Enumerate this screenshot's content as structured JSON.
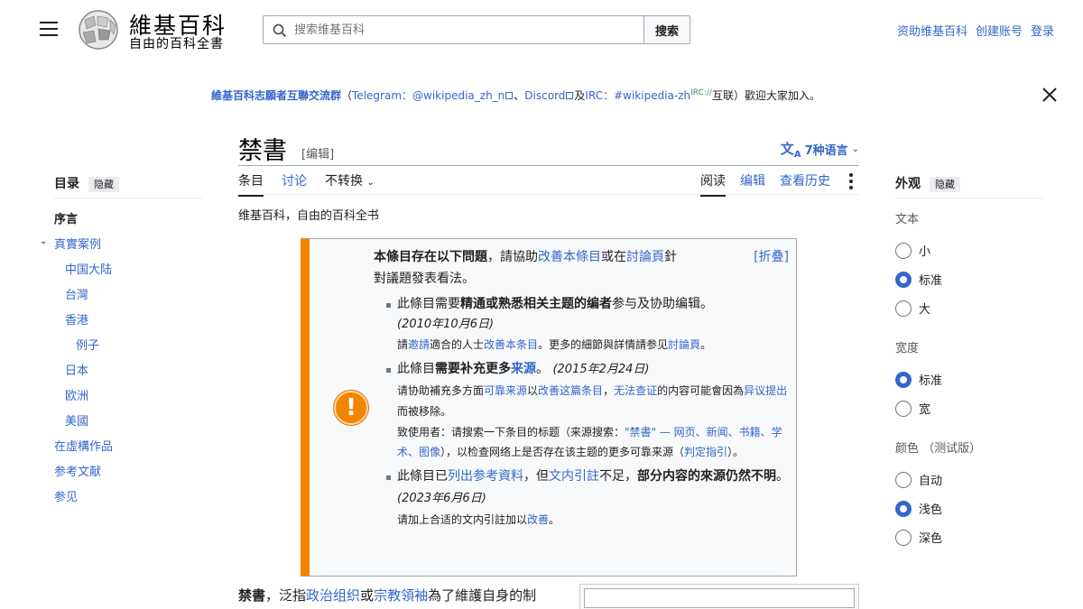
{
  "header": {
    "logo_title": "維基百科",
    "logo_tagline": "自由的百科全書",
    "search_placeholder": "搜索维基百科",
    "search_button": "搜索",
    "user_links": [
      "资助维基百科",
      "创建账号",
      "登录"
    ]
  },
  "banner": {
    "group_name": "維基百科志願者互聯交流群",
    "open_paren": "（",
    "telegram_label": "Telegram：",
    "telegram_link": "@wikipedia_zh_n",
    "sep": "、",
    "discord": "Discord",
    "and": "及",
    "irc_label": "IRC：",
    "irc_link": "#wikipedia-zh",
    "irc_sup": "IRC://",
    "tail": "互联）歡迎大家加入。"
  },
  "page": {
    "title": "禁書",
    "edit": "[编辑]",
    "languages": "7种语言",
    "tabs_left": [
      "条目",
      "讨论",
      "不转换"
    ],
    "tabs_right": [
      "阅读",
      "编辑",
      "查看历史"
    ],
    "subtitle": "维基百科，自由的百科全书"
  },
  "toc": {
    "title": "目录",
    "hide": "隐藏",
    "items": [
      "序言",
      "真實案例",
      "中国大陆",
      "台灣",
      "香港",
      "例子",
      "日本",
      "欧洲",
      "美國",
      "在虛構作品",
      "参考文献",
      "参见"
    ]
  },
  "notice": {
    "intro_bold": "本條目存在以下問題",
    "intro_mid": "，請協助",
    "intro_link1": "改善本條目",
    "intro_or": "或在",
    "intro_link2": "討論頁",
    "intro_end": "針",
    "collapse": "[折叠]",
    "intro_line2": "對議題發表看法。",
    "issue1_a": "此條目需要",
    "issue1_bold": "精通或熟悉相关主题的编者",
    "issue1_b": "参与及协助编辑。",
    "issue1_date": "(2010年10月6日)",
    "issue1_note_a": "請",
    "issue1_note_l1": "邀請",
    "issue1_note_b": "適合的人士",
    "issue1_note_l2": "改善本条目",
    "issue1_note_c": "。更多的細節與詳情請参见",
    "issue1_note_l3": "討論頁",
    "issue1_note_d": "。",
    "issue2_a": "此條目",
    "issue2_bold": "需要补充更多",
    "issue2_link": "来源",
    "issue2_b": "。",
    "issue2_date": "(2015年2月24日)",
    "issue2_n1": "请协助補充多方面",
    "issue2_n1l": "可靠来源",
    "issue2_n2": "以",
    "issue2_n2l": "改善这篇条目",
    "issue2_n3": "，",
    "issue2_n3l": "无法查证",
    "issue2_n4": "的内容可能會因為",
    "issue2_n4l": "异议提出",
    "issue2_n5": "而被移除。",
    "issue2_s1": "致使用者：请搜索一下条目的标题（来源搜索：",
    "issue2_s1l": "\"禁書\" — 网页、新闻、书籍、学术、图像",
    "issue2_s2": "），以检查网络上是否存在该主题的更多可靠来源（",
    "issue2_s2l": "判定指引",
    "issue2_s3": "）。",
    "issue3_a": "此條目已",
    "issue3_l1": "列出参考資料",
    "issue3_b": "，但",
    "issue3_l2": "文内引註",
    "issue3_c": "不足，",
    "issue3_bold": "部分内容的來源仍然不明",
    "issue3_d": "。",
    "issue3_date": "(2023年6月6日)",
    "issue3_note": "请加上合适的文内引註加以",
    "issue3_note_l": "改善",
    "issue3_note_end": "。"
  },
  "appearance": {
    "title": "外观",
    "hide": "隐藏",
    "text_label": "文本",
    "text_options": [
      "小",
      "标准",
      "大"
    ],
    "width_label": "宽度",
    "width_options": [
      "标准",
      "宽"
    ],
    "color_label": "颜色 （测试版）",
    "color_options": [
      "自动",
      "浅色",
      "深色"
    ]
  },
  "lead": {
    "bold": "禁書",
    "a": "，泛指",
    "l1": "政治组织",
    "b": "或",
    "l2": "宗教領袖",
    "c": "為了維護自身的制"
  },
  "colors": {
    "link": "#3366cc",
    "notice_bar": "#f28500",
    "radio_on": "#3366cc"
  }
}
